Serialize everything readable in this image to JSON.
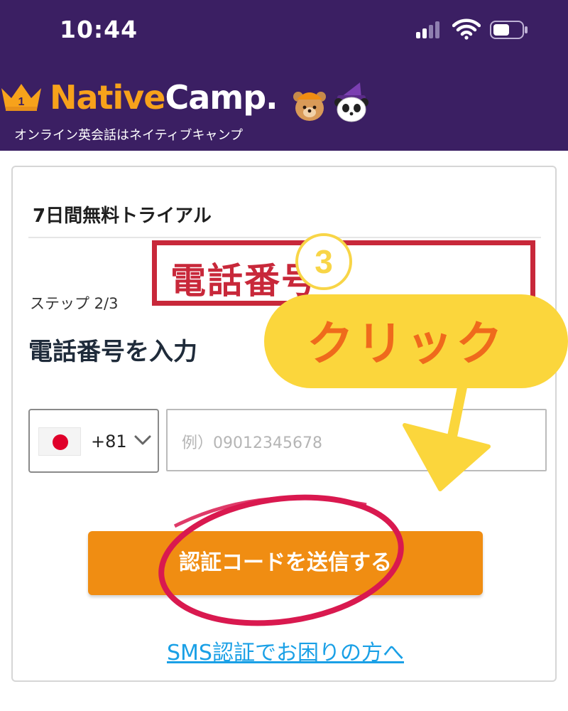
{
  "status_bar": {
    "time": "10:44"
  },
  "header": {
    "logo_part1": "Native",
    "logo_part2": "Camp.",
    "crown_number": "1",
    "tagline": "オンライン英会話はネイティブキャンプ"
  },
  "card": {
    "title": "7日間無料トライアル",
    "step_label": "ステップ 2/3",
    "heading": "電話番号を入力",
    "country_code": "+81",
    "phone_placeholder": "例）09012345678",
    "send_button": "認証コードを送信する",
    "sms_link": "SMS認証でお困りの方へ"
  },
  "annotations": {
    "step_number": "3",
    "click_bubble": "クリック",
    "phone_label": "電話番号"
  },
  "colors": {
    "header_bg": "#3b1f63",
    "brand_orange": "#f7a21b",
    "button_orange": "#f08d12",
    "link_blue": "#1aa0e6",
    "annotation_red": "#c8283a",
    "bubble_yellow": "#fbd63c",
    "bubble_text_orange": "#ef6a1c"
  },
  "icons": {
    "signal": "cellular-signal-icon",
    "wifi": "wifi-icon",
    "battery": "battery-icon",
    "crown": "crown-icon",
    "flag": "japan-flag-icon",
    "chevron": "chevron-down-icon"
  }
}
